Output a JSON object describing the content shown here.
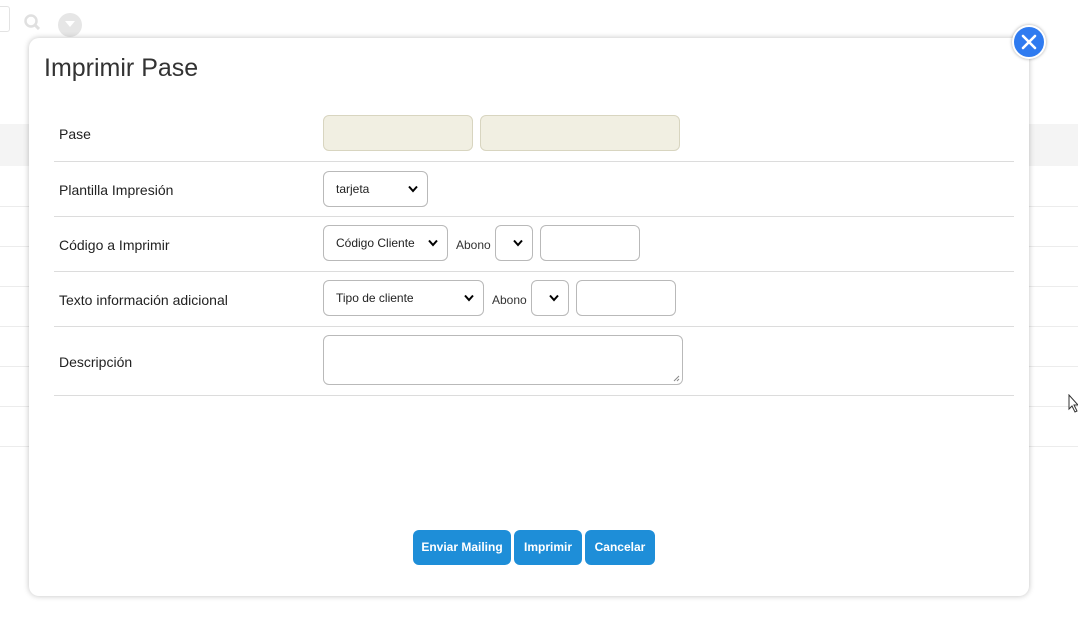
{
  "modal": {
    "title": "Imprimir Pase"
  },
  "rows": [
    {
      "label": "Pase"
    },
    {
      "label": "Plantilla Impresión",
      "select_value": "tarjeta"
    },
    {
      "label": "Código a Imprimir",
      "select_value": "Código Cliente",
      "abono_label": "Abono",
      "abono_value": "",
      "text_value": ""
    },
    {
      "label": "Texto información adicional",
      "select_value": "Tipo de cliente",
      "abono_label": "Abono",
      "abono_value": "",
      "text_value": ""
    },
    {
      "label": "Descripción",
      "text_value": ""
    }
  ],
  "buttons": {
    "mailing": "Enviar Mailing",
    "print": "Imprimir",
    "cancel": "Cancelar"
  },
  "colors": {
    "accent": "#1e8ed8",
    "close": "#2f7bf0",
    "readonly": "#f1efe2"
  }
}
